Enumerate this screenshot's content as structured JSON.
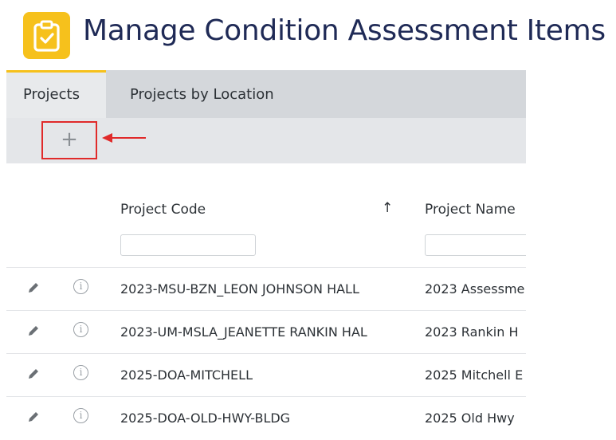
{
  "page": {
    "title": "Manage Condition Assessment Items",
    "icon": "clipboard-check-icon",
    "accent_color": "#f6c11c"
  },
  "tabs": [
    {
      "label": "Projects",
      "active": true
    },
    {
      "label": "Projects by Location",
      "active": false
    }
  ],
  "toolbar": {
    "add_label": "+"
  },
  "grid": {
    "columns": [
      {
        "title": "Project Code",
        "sort": "ascending"
      },
      {
        "title": "Project Name"
      }
    ],
    "sort_glyph": "↑",
    "info_glyph": "i",
    "rows": [
      {
        "code": "2023-MSU-BZN_LEON JOHNSON HALL",
        "name": "2023 Assessme"
      },
      {
        "code": "2023-UM-MSLA_JEANETTE RANKIN HAL",
        "name": "2023 Rankin H"
      },
      {
        "code": "2025-DOA-MITCHELL",
        "name": "2025 Mitchell E"
      },
      {
        "code": "2025-DOA-OLD-HWY-BLDG",
        "name": "2025 Old Hwy"
      }
    ]
  }
}
